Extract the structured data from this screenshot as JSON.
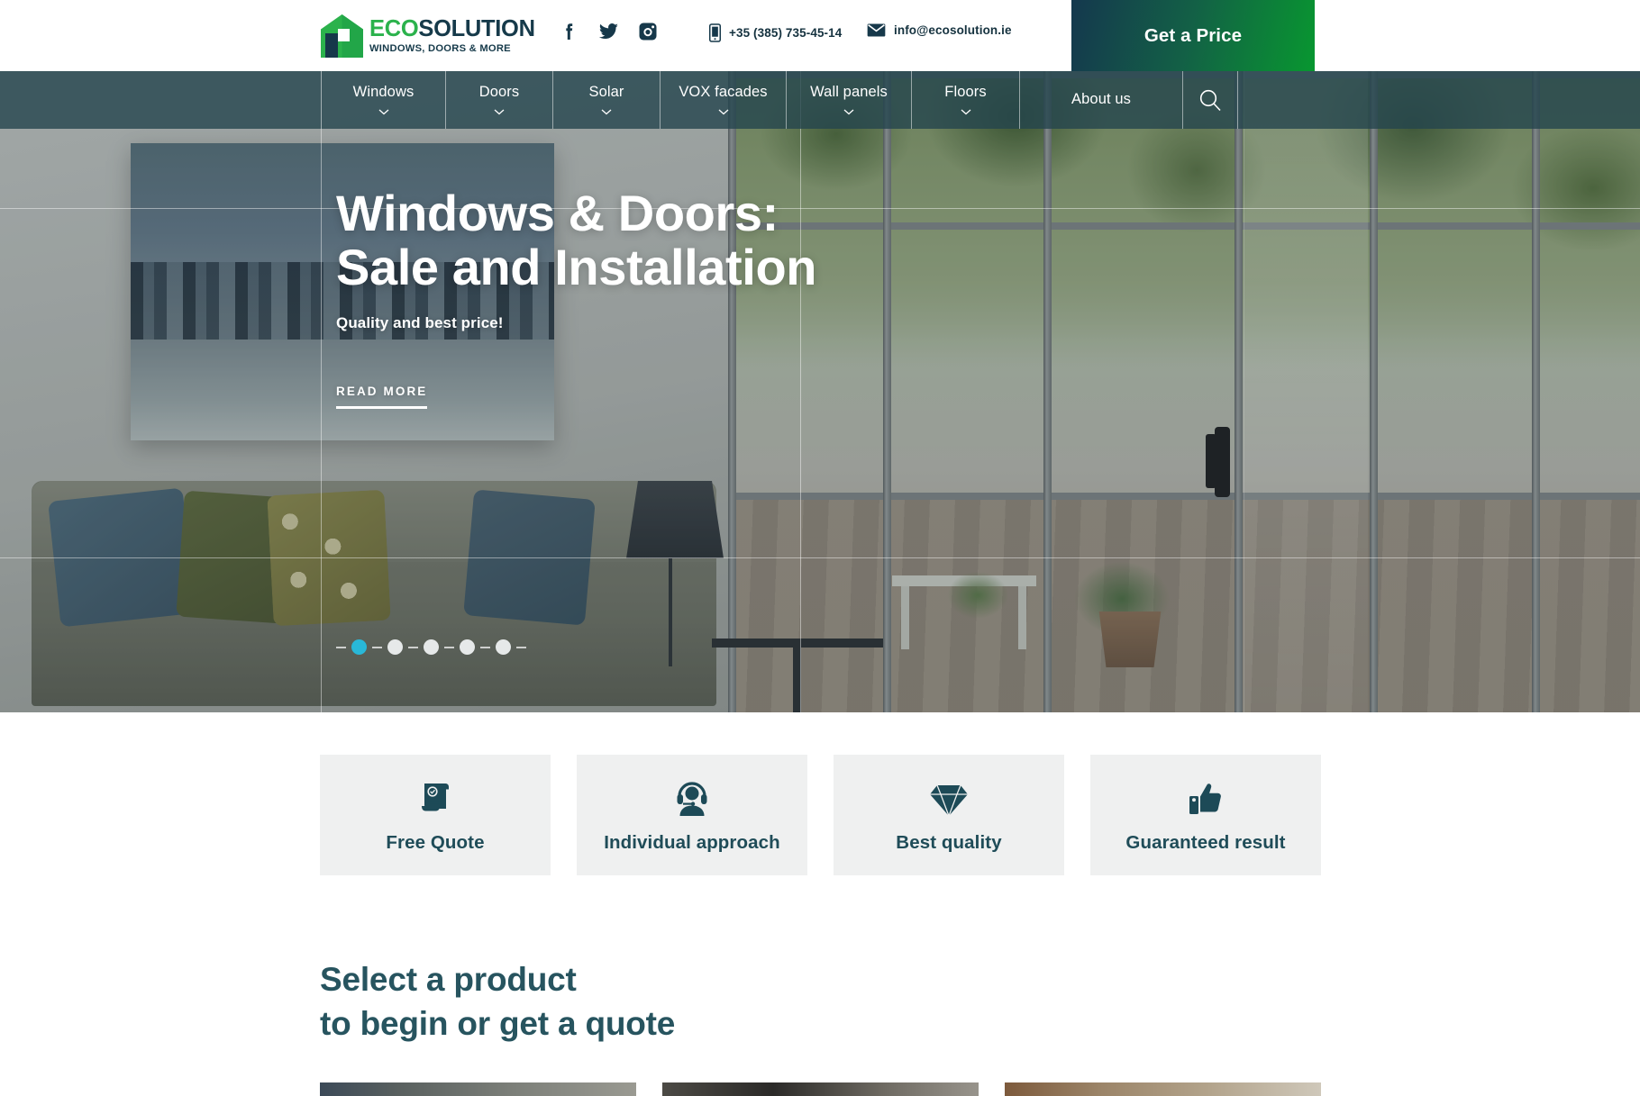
{
  "brand": {
    "logo_icon": "house-logo-icon",
    "name_part1": "ECO",
    "name_part2": "SOLUTION",
    "tagline": "WINDOWS, DOORS & MORE",
    "green": "#2bb24c",
    "navy": "#163a4a"
  },
  "topbar": {
    "socials": [
      {
        "name": "facebook-icon",
        "label": "Facebook"
      },
      {
        "name": "twitter-icon",
        "label": "Twitter"
      },
      {
        "name": "instagram-icon",
        "label": "Instagram"
      }
    ],
    "phone_icon": "phone-icon",
    "phone": "+35 (385) 735-45-14",
    "email_icon": "email-icon",
    "email": "info@ecosolution.ie",
    "cta_label": "Get a Price"
  },
  "nav": {
    "items": [
      {
        "label": "Windows",
        "has_dropdown": true
      },
      {
        "label": "Doors",
        "has_dropdown": true
      },
      {
        "label": "Solar",
        "has_dropdown": true
      },
      {
        "label": "VOX facades",
        "has_dropdown": true
      },
      {
        "label": "Wall panels",
        "has_dropdown": true
      },
      {
        "label": "Floors",
        "has_dropdown": true
      }
    ],
    "about_label": "About us",
    "search_icon": "search-icon"
  },
  "hero": {
    "title_line1": "Windows & Doors:",
    "title_line2": "Sale and Installation",
    "subtitle": "Quality and best price!",
    "cta_label": "READ MORE",
    "carousel": {
      "total": 5,
      "active_index": 0,
      "active_color": "#29b8d8",
      "inactive_color": "#e6e9e9"
    }
  },
  "features": [
    {
      "icon": "certificate-scroll-icon",
      "label": "Free Quote"
    },
    {
      "icon": "headset-support-icon",
      "label": "Individual approach"
    },
    {
      "icon": "diamond-icon",
      "label": "Best quality"
    },
    {
      "icon": "thumbs-up-icon",
      "label": "Guaranteed result"
    }
  ],
  "products_section": {
    "title_line1": "Select a product",
    "title_line2": "to begin or get a quote",
    "cards": [
      {
        "name": "product-card-1"
      },
      {
        "name": "product-card-2"
      },
      {
        "name": "product-card-3"
      }
    ]
  }
}
